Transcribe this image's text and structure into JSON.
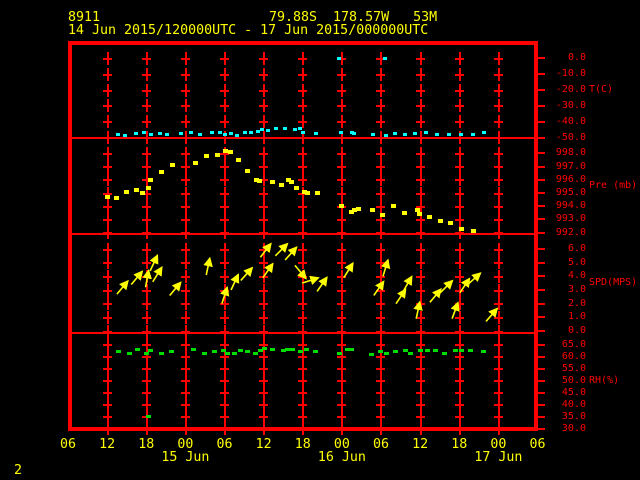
{
  "header": {
    "station_id": "8911",
    "position": "79.88S  178.57W   53M",
    "time_range": "14 Jun 2015/120000UTC - 17 Jun 2015/000000UTC"
  },
  "footer": {
    "page_label": "2"
  },
  "colors": {
    "background": "#000000",
    "grid": "#ff0000",
    "text": "#ffff00",
    "temperature": "#00ffff",
    "pressure": "#ffff00",
    "wind": "#ffff00",
    "rh": "#00dd00"
  },
  "x_axis": {
    "hour_labels": [
      "06",
      "12",
      "18",
      "00",
      "06",
      "12",
      "18",
      "00",
      "06",
      "12",
      "18",
      "00",
      "06"
    ],
    "date_labels": [
      {
        "t": 18,
        "label": "15 Jun"
      },
      {
        "t": 42,
        "label": "16 Jun"
      },
      {
        "t": 66,
        "label": "17 Jun"
      }
    ]
  },
  "panels": [
    {
      "id": "temperature",
      "axis_title": "T(C)",
      "title_value": -20,
      "ticks": [
        {
          "label": "0.0",
          "value": 0
        },
        {
          "label": "-10.0",
          "value": -10
        },
        {
          "label": "-20.0",
          "value": -20
        },
        {
          "label": "-30.0",
          "value": -30
        },
        {
          "label": "-40.0",
          "value": -40
        },
        {
          "label": "-50.0",
          "value": -50
        }
      ]
    },
    {
      "id": "pressure",
      "axis_title": "Pre (mb)",
      "title_value": 995.5,
      "ticks": [
        {
          "label": "998.0",
          "value": 998
        },
        {
          "label": "997.0",
          "value": 997
        },
        {
          "label": "996.0",
          "value": 996
        },
        {
          "label": "995.0",
          "value": 995
        },
        {
          "label": "994.0",
          "value": 994
        },
        {
          "label": "993.0",
          "value": 993
        },
        {
          "label": "992.0",
          "value": 992
        }
      ]
    },
    {
      "id": "wind",
      "axis_title": "SPD(MPS)",
      "title_value": 3.5,
      "ticks": [
        {
          "label": "6.0",
          "value": 6
        },
        {
          "label": "5.0",
          "value": 5
        },
        {
          "label": "4.0",
          "value": 4
        },
        {
          "label": "3.0",
          "value": 3
        },
        {
          "label": "2.0",
          "value": 2
        },
        {
          "label": "1.0",
          "value": 1
        },
        {
          "label": "0.0",
          "value": 0
        }
      ]
    },
    {
      "id": "rh",
      "axis_title": "RH(%)",
      "title_value": 50,
      "ticks": [
        {
          "label": "65.0",
          "value": 65
        },
        {
          "label": "60.0",
          "value": 60
        },
        {
          "label": "55.0",
          "value": 55
        },
        {
          "label": "50.0",
          "value": 50
        },
        {
          "label": "45.0",
          "value": 45
        },
        {
          "label": "40.0",
          "value": 40
        },
        {
          "label": "35.0",
          "value": 35
        },
        {
          "label": "30.0",
          "value": 30
        }
      ]
    }
  ],
  "chart_data": {
    "type": "scatter",
    "title": "Station 8911 surface observations 14 Jun 2015 1200UTC - 17 Jun 2015 0000UTC",
    "x_axis": {
      "unit": "hours since 14 Jun 2015 0600UTC",
      "range": [
        0,
        72
      ],
      "tick_interval_hours": 6
    },
    "series": [
      {
        "name": "T(C)",
        "panel": "temperature",
        "color": "#00ffff",
        "axis_range": [
          0,
          -50
        ],
        "points": [
          [
            7.7,
            -48.2
          ],
          [
            8.7,
            -48.8
          ],
          [
            10.4,
            -47.6
          ],
          [
            11.7,
            -47.0
          ],
          [
            12.7,
            -48.2
          ],
          [
            14.1,
            -47.6
          ],
          [
            15.2,
            -48.2
          ],
          [
            17.3,
            -47.6
          ],
          [
            18.9,
            -47.0
          ],
          [
            20.2,
            -48.2
          ],
          [
            22.1,
            -47.0
          ],
          [
            23.3,
            -47.0
          ],
          [
            24.1,
            -48.2
          ],
          [
            25.0,
            -47.6
          ],
          [
            25.9,
            -48.8
          ],
          [
            27.2,
            -47.0
          ],
          [
            28.1,
            -47.0
          ],
          [
            29.1,
            -46.4
          ],
          [
            29.8,
            -45.1
          ],
          [
            30.7,
            -45.7
          ],
          [
            31.9,
            -44.5
          ],
          [
            33.3,
            -44.5
          ],
          [
            34.8,
            -45.1
          ],
          [
            35.6,
            -44.5
          ],
          [
            36.0,
            -47.0
          ],
          [
            38.0,
            -47.6
          ],
          [
            41.6,
            0.0
          ],
          [
            41.8,
            -46.5
          ],
          [
            43.6,
            -47.0
          ],
          [
            43.9,
            -47.6
          ],
          [
            46.8,
            -48.2
          ],
          [
            48.6,
            0.0
          ],
          [
            48.8,
            -48.8
          ],
          [
            50.2,
            -47.6
          ],
          [
            51.7,
            -48.2
          ],
          [
            53.2,
            -47.6
          ],
          [
            54.9,
            -47.0
          ],
          [
            56.6,
            -48.2
          ],
          [
            58.4,
            -48.2
          ],
          [
            60.3,
            -48.2
          ],
          [
            62.1,
            -48.2
          ],
          [
            63.8,
            -47.0
          ]
        ]
      },
      {
        "name": "Pre (mb)",
        "panel": "pressure",
        "color": "#ffff00",
        "axis_range": [
          998,
          992
        ],
        "points": [
          [
            6.0,
            994.7
          ],
          [
            7.4,
            994.6
          ],
          [
            8.9,
            995.1
          ],
          [
            10.5,
            995.2
          ],
          [
            11.5,
            995.0
          ],
          [
            12.3,
            995.4
          ],
          [
            12.7,
            996.0
          ],
          [
            14.4,
            996.6
          ],
          [
            16.1,
            997.1
          ],
          [
            19.5,
            997.3
          ],
          [
            21.3,
            997.8
          ],
          [
            22.9,
            997.9
          ],
          [
            24.1,
            998.2
          ],
          [
            24.9,
            998.1
          ],
          [
            26.1,
            997.5
          ],
          [
            27.6,
            996.7
          ],
          [
            28.9,
            996.0
          ],
          [
            29.4,
            995.9
          ],
          [
            31.3,
            995.8
          ],
          [
            32.7,
            995.6
          ],
          [
            33.8,
            996.0
          ],
          [
            34.2,
            995.8
          ],
          [
            35.0,
            995.4
          ],
          [
            36.2,
            995.1
          ],
          [
            36.7,
            995.0
          ],
          [
            38.2,
            995.0
          ],
          [
            41.9,
            994.0
          ],
          [
            43.4,
            993.6
          ],
          [
            43.9,
            993.7
          ],
          [
            44.5,
            993.8
          ],
          [
            46.7,
            993.7
          ],
          [
            48.2,
            993.3
          ],
          [
            49.9,
            994.0
          ],
          [
            51.6,
            993.5
          ],
          [
            53.6,
            993.7
          ],
          [
            53.9,
            993.4
          ],
          [
            55.4,
            993.2
          ],
          [
            57.1,
            992.9
          ],
          [
            58.6,
            992.7
          ],
          [
            60.3,
            992.3
          ],
          [
            62.2,
            992.1
          ]
        ]
      },
      {
        "name": "SPD(MPS)",
        "panel": "wind",
        "color": "#ffff00",
        "axis_range": [
          6,
          0
        ],
        "vectors_t_speed_dir": [
          [
            7.5,
            2.7,
            50
          ],
          [
            9.7,
            3.4,
            50
          ],
          [
            11.9,
            3.2,
            80
          ],
          [
            12.6,
            4.4,
            65
          ],
          [
            13.0,
            3.6,
            58
          ],
          [
            15.6,
            2.6,
            50
          ],
          [
            21.2,
            4.1,
            78
          ],
          [
            23.6,
            2.0,
            72
          ],
          [
            25.0,
            3.0,
            65
          ],
          [
            26.5,
            3.7,
            48
          ],
          [
            29.5,
            5.4,
            52
          ],
          [
            29.9,
            3.9,
            55
          ],
          [
            31.8,
            5.5,
            45
          ],
          [
            33.3,
            5.2,
            48
          ],
          [
            34.8,
            4.8,
            -50
          ],
          [
            35.9,
            3.5,
            18
          ],
          [
            38.2,
            2.9,
            55
          ],
          [
            42.3,
            3.9,
            58
          ],
          [
            46.9,
            2.6,
            55
          ],
          [
            48.3,
            4.0,
            73
          ],
          [
            50.3,
            2.0,
            56
          ],
          [
            51.4,
            2.9,
            60
          ],
          [
            53.4,
            0.9,
            78
          ],
          [
            55.5,
            2.1,
            50
          ],
          [
            57.1,
            2.8,
            45
          ],
          [
            58.9,
            0.9,
            70
          ],
          [
            60.1,
            2.8,
            56
          ],
          [
            61.3,
            3.4,
            42
          ],
          [
            64.1,
            0.7,
            49
          ]
        ]
      },
      {
        "name": "RH(%)",
        "panel": "rh",
        "color": "#00dd00",
        "axis_range": [
          65,
          30
        ],
        "points": [
          [
            7.7,
            62.0
          ],
          [
            9.5,
            61.5
          ],
          [
            10.7,
            62.8
          ],
          [
            12.0,
            61.5
          ],
          [
            12.3,
            35.2
          ],
          [
            12.7,
            62.4
          ],
          [
            14.3,
            61.5
          ],
          [
            15.8,
            62.0
          ],
          [
            19.3,
            62.8
          ],
          [
            21.0,
            61.5
          ],
          [
            22.5,
            62.0
          ],
          [
            23.9,
            62.4
          ],
          [
            24.5,
            61.5
          ],
          [
            25.6,
            61.5
          ],
          [
            26.5,
            62.4
          ],
          [
            27.6,
            62.0
          ],
          [
            28.8,
            61.5
          ],
          [
            29.5,
            62.4
          ],
          [
            30.2,
            63.6
          ],
          [
            31.4,
            62.8
          ],
          [
            33.0,
            62.4
          ],
          [
            33.6,
            62.8
          ],
          [
            34.4,
            62.8
          ],
          [
            35.6,
            62.0
          ],
          [
            36.5,
            62.8
          ],
          [
            38.0,
            62.0
          ],
          [
            41.7,
            61.5
          ],
          [
            42.8,
            62.8
          ],
          [
            43.4,
            62.8
          ],
          [
            46.6,
            61.1
          ],
          [
            47.9,
            62.0
          ],
          [
            48.9,
            61.5
          ],
          [
            50.3,
            62.0
          ],
          [
            51.7,
            62.4
          ],
          [
            52.6,
            61.5
          ],
          [
            54.0,
            62.4
          ],
          [
            55.2,
            62.4
          ],
          [
            56.4,
            62.4
          ],
          [
            57.8,
            61.5
          ],
          [
            59.4,
            62.4
          ],
          [
            60.3,
            62.4
          ],
          [
            61.8,
            62.4
          ],
          [
            63.7,
            62.0
          ]
        ]
      }
    ]
  }
}
